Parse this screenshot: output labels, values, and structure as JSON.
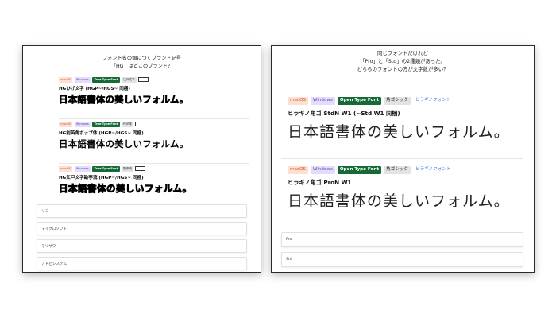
{
  "left_quiz": {
    "question_line1": "フォント名の頭につくブランド記号",
    "question_line2": "「HG」はどこのブランド？",
    "fonts": [
      {
        "badges": [
          "macOS",
          "Windows",
          "True Type Font",
          "江戸文字"
        ],
        "name": "HGひげ文字 (HGP~/HGS~ 同梱)",
        "sample": "日本語書体の美しいフォルム。"
      },
      {
        "badges": [
          "macOS",
          "Windows",
          "True Type Font",
          "POP体"
        ],
        "name": "HG創英角ポップ体 (HGP~/HGS~ 同梱)",
        "sample": "日本語書体の美しいフォルム。"
      },
      {
        "badges": [
          "macOS",
          "Windows",
          "True Type Font",
          "勘亭流"
        ],
        "name": "HG江戸文字勘亭流 (HGP~/HGS~ 同梱)",
        "sample": "日本語書体の美しいフォルム。"
      }
    ],
    "options": [
      "リコー",
      "マイクロソフト",
      "モリサワ",
      "アドビシステム"
    ]
  },
  "right_quiz": {
    "question_line1": "同じフォントだけれど",
    "question_line2": "「Pro」と「Std」の2種類があった。",
    "question_line3": "どちらのフォントの方が文字数が多い？",
    "fonts": [
      {
        "badges": [
          "macOS",
          "Windows",
          "Open Type Font",
          "角ゴシック"
        ],
        "link": "ヒラギノフォント",
        "name": "ヒラギノ角ゴ StdN W1 (~Std W1 同梱)",
        "sample": "日本語書体の美しいフォルム。"
      },
      {
        "badges": [
          "macOS",
          "Windows",
          "Open Type Font",
          "角ゴシック"
        ],
        "link": "ヒラギノフォント",
        "name": "ヒラギノ角ゴ ProN W1",
        "sample": "日本語書体の美しいフォルム。"
      }
    ],
    "options": [
      "Pro",
      "Std"
    ]
  }
}
